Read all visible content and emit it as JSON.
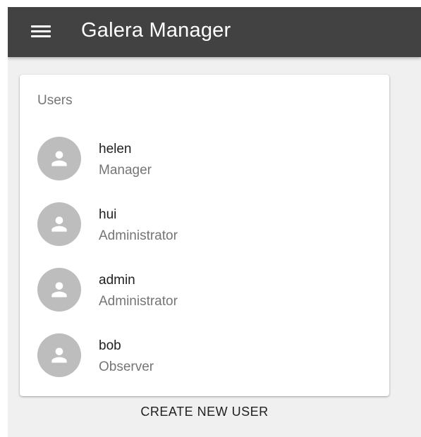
{
  "app": {
    "title": "Galera Manager",
    "menu_icon": "hamburger-menu-icon",
    "bar_color": "#424242"
  },
  "users_card": {
    "title": "Users",
    "users": [
      {
        "name": "helen",
        "role": "Manager",
        "icon": "person-icon"
      },
      {
        "name": "hui",
        "role": "Administrator",
        "icon": "person-icon"
      },
      {
        "name": "admin",
        "role": "Administrator",
        "icon": "person-icon"
      },
      {
        "name": "bob",
        "role": "Observer",
        "icon": "person-icon"
      }
    ]
  },
  "actions": {
    "create_user_label": "CREATE NEW USER"
  }
}
